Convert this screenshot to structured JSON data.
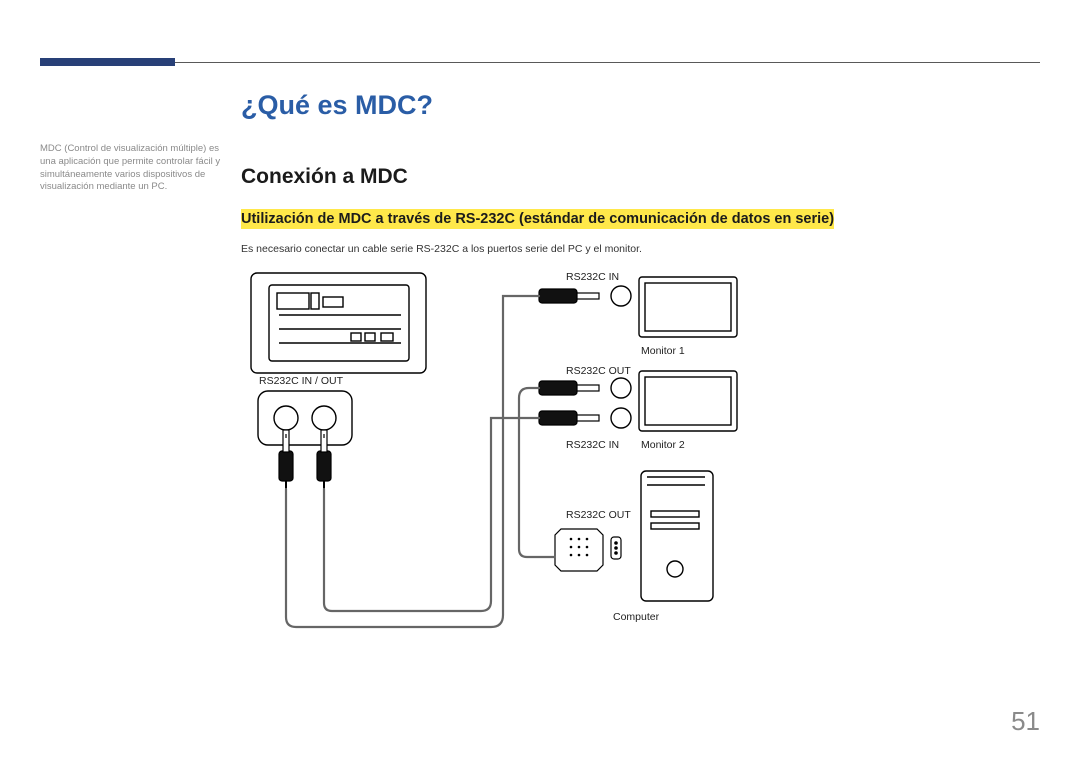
{
  "sidebar": {
    "note": "MDC (Control de visualización múltiple) es una aplicación que permite controlar fácil y simultáneamente varios dispositivos de visualización mediante un PC."
  },
  "headings": {
    "h1": "¿Qué es MDC?",
    "h2": "Conexión a MDC",
    "h3": "Utilización de MDC a través de RS-232C (estándar de comunicación de datos en serie)"
  },
  "body": {
    "p1": "Es necesario conectar un cable serie RS-232C a los puertos serie del PC y el monitor."
  },
  "diagram": {
    "labels": {
      "inout": "RS232C IN / OUT",
      "in1": "RS232C IN",
      "out1": "RS232C OUT",
      "in2": "RS232C IN",
      "out2": "RS232C OUT",
      "monitor1": "Monitor 1",
      "monitor2": "Monitor 2",
      "computer": "Computer"
    }
  },
  "page": {
    "number": "51"
  }
}
